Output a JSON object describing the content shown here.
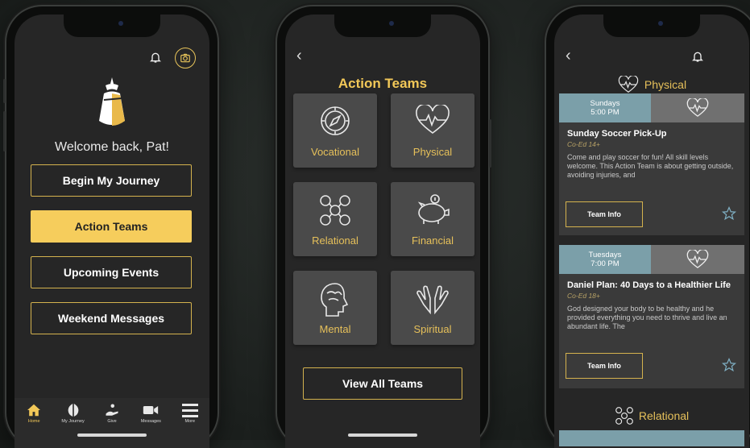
{
  "phone1": {
    "welcome": "Welcome back, Pat!",
    "buttons": [
      {
        "label": "Begin My Journey"
      },
      {
        "label": "Action Teams"
      },
      {
        "label": "Upcoming Events"
      },
      {
        "label": "Weekend Messages"
      }
    ],
    "tabs": [
      {
        "label": "Home",
        "icon": "home-icon"
      },
      {
        "label": "My Journey",
        "icon": "journey-icon"
      },
      {
        "label": "Give",
        "icon": "give-icon"
      },
      {
        "label": "Messages",
        "icon": "video-icon"
      },
      {
        "label": "More",
        "icon": "menu-icon"
      }
    ]
  },
  "phone2": {
    "title": "Action Teams",
    "tiles": [
      {
        "label": "Vocational",
        "icon": "compass-icon"
      },
      {
        "label": "Physical",
        "icon": "heartbeat-icon"
      },
      {
        "label": "Relational",
        "icon": "people-network-icon"
      },
      {
        "label": "Financial",
        "icon": "piggy-bank-icon"
      },
      {
        "label": "Mental",
        "icon": "brain-icon"
      },
      {
        "label": "Spiritual",
        "icon": "praying-hands-icon"
      }
    ],
    "view_all": "View All Teams"
  },
  "phone3": {
    "section1": "Physical",
    "section2": "Relational",
    "cards": [
      {
        "day": "Sundays",
        "time": "5:00 PM",
        "title": "Sunday Soccer Pick-Up",
        "subtitle": "Co-Ed 14+",
        "desc": "Come and play soccer for fun! All skill levels welcome. This Action Team is about getting outside, avoiding injuries, and",
        "button": "Team Info"
      },
      {
        "day": "Tuesdays",
        "time": "7:00 PM",
        "title": "Daniel Plan: 40 Days to a Healthier Life",
        "subtitle": "Co-Ed 18+",
        "desc": "God designed your body to be healthy and he provided everything you need to thrive and live an abundant life. The",
        "button": "Team Info"
      }
    ]
  },
  "colors": {
    "accent": "#f6cd5c",
    "screen_bg": "#262626",
    "tile_bg": "#4a4a4a",
    "date_bg": "#7b9fa9"
  }
}
